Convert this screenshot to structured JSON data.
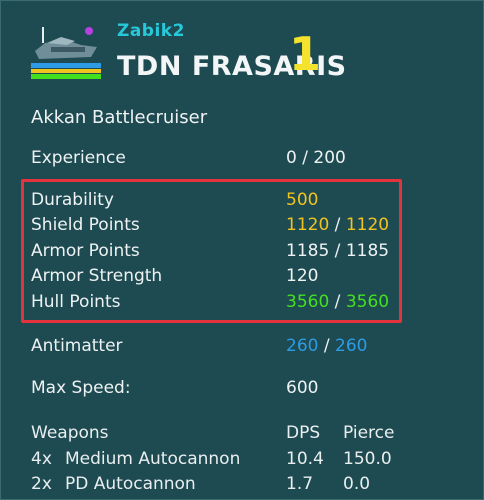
{
  "header": {
    "owner": "Zabik2",
    "ship_name": "TDN FRASARIS",
    "level": "1",
    "ship_icon": "battlecruiser-ship-icon"
  },
  "ship_class": "Akkan Battlecruiser",
  "experience": {
    "label": "Experience",
    "current": "0",
    "sep": "/",
    "max": "200"
  },
  "stats": {
    "durability": {
      "label": "Durability",
      "value": "500"
    },
    "shield_points": {
      "label": "Shield Points",
      "current": "1120",
      "sep": "/",
      "max": "1120"
    },
    "armor_points": {
      "label": "Armor Points",
      "current": "1185",
      "sep": "/",
      "max": "1185"
    },
    "armor_strength": {
      "label": "Armor Strength",
      "value": "120"
    },
    "hull_points": {
      "label": "Hull Points",
      "current": "3560",
      "sep": "/",
      "max": "3560"
    }
  },
  "antimatter": {
    "label": "Antimatter",
    "current": "260",
    "sep": "/",
    "max": "260"
  },
  "max_speed": {
    "label": "Max Speed:",
    "value": "600"
  },
  "weapons": {
    "label": "Weapons",
    "col_dps": "DPS",
    "col_pierce": "Pierce",
    "items": [
      {
        "count": "4x",
        "name": "Medium Autocannon",
        "dps": "10.4",
        "pierce": "150.0"
      },
      {
        "count": "2x",
        "name": "PD Autocannon",
        "dps": "1.7",
        "pierce": "0.0"
      }
    ]
  },
  "colors": {
    "background": "#1e4b51",
    "owner": "#27c8d9",
    "level": "#f4e22c",
    "durability": "#f1c31f",
    "hull": "#44e01f",
    "antimatter": "#2d9be6",
    "highlight_border": "#e3333d"
  }
}
